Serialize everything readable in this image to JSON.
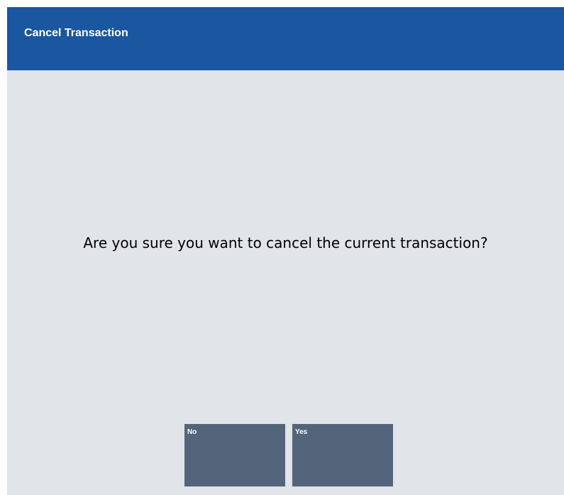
{
  "dialog": {
    "title": "Cancel Transaction",
    "message": "Are you sure you want to cancel the current transaction?"
  },
  "buttons": {
    "no_label": "No",
    "yes_label": "Yes"
  },
  "colors": {
    "title_bar": "#1b56a0",
    "background": "#e1e4e8",
    "button": "#54647a"
  }
}
